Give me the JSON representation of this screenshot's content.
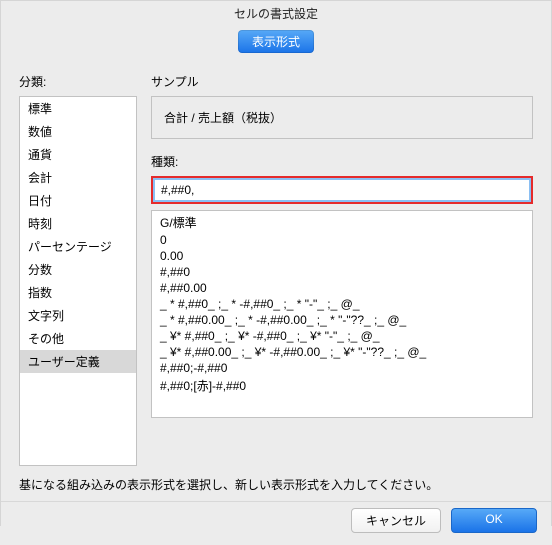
{
  "title": "セルの書式設定",
  "tab": "表示形式",
  "left_label": "分類:",
  "categories": [
    "標準",
    "数値",
    "通貨",
    "会計",
    "日付",
    "時刻",
    "パーセンテージ",
    "分数",
    "指数",
    "文字列",
    "その他",
    "ユーザー定義"
  ],
  "selected_category_index": 11,
  "sample_label": "サンプル",
  "sample_value": "合計 / 売上額（税抜）",
  "type_label": "種類:",
  "type_value": "#,##0,",
  "type_options": [
    "G/標準",
    "0",
    "0.00",
    "#,##0",
    "#,##0.00",
    "_ * #,##0_ ;_ * -#,##0_ ;_ * \"-\"_ ;_ @_ ",
    "_ * #,##0.00_ ;_ * -#,##0.00_ ;_ * \"-\"??_ ;_ @_ ",
    "_ ¥* #,##0_ ;_ ¥* -#,##0_ ;_ ¥* \"-\"_ ;_ @_ ",
    "_ ¥* #,##0.00_ ;_ ¥* -#,##0.00_ ;_ ¥* \"-\"??_ ;_ @_ ",
    "#,##0;-#,##0",
    "#,##0;[赤]-#,##0"
  ],
  "hint": "基になる組み込みの表示形式を選択し、新しい表示形式を入力してください。",
  "buttons": {
    "cancel": "キャンセル",
    "ok": "OK"
  }
}
